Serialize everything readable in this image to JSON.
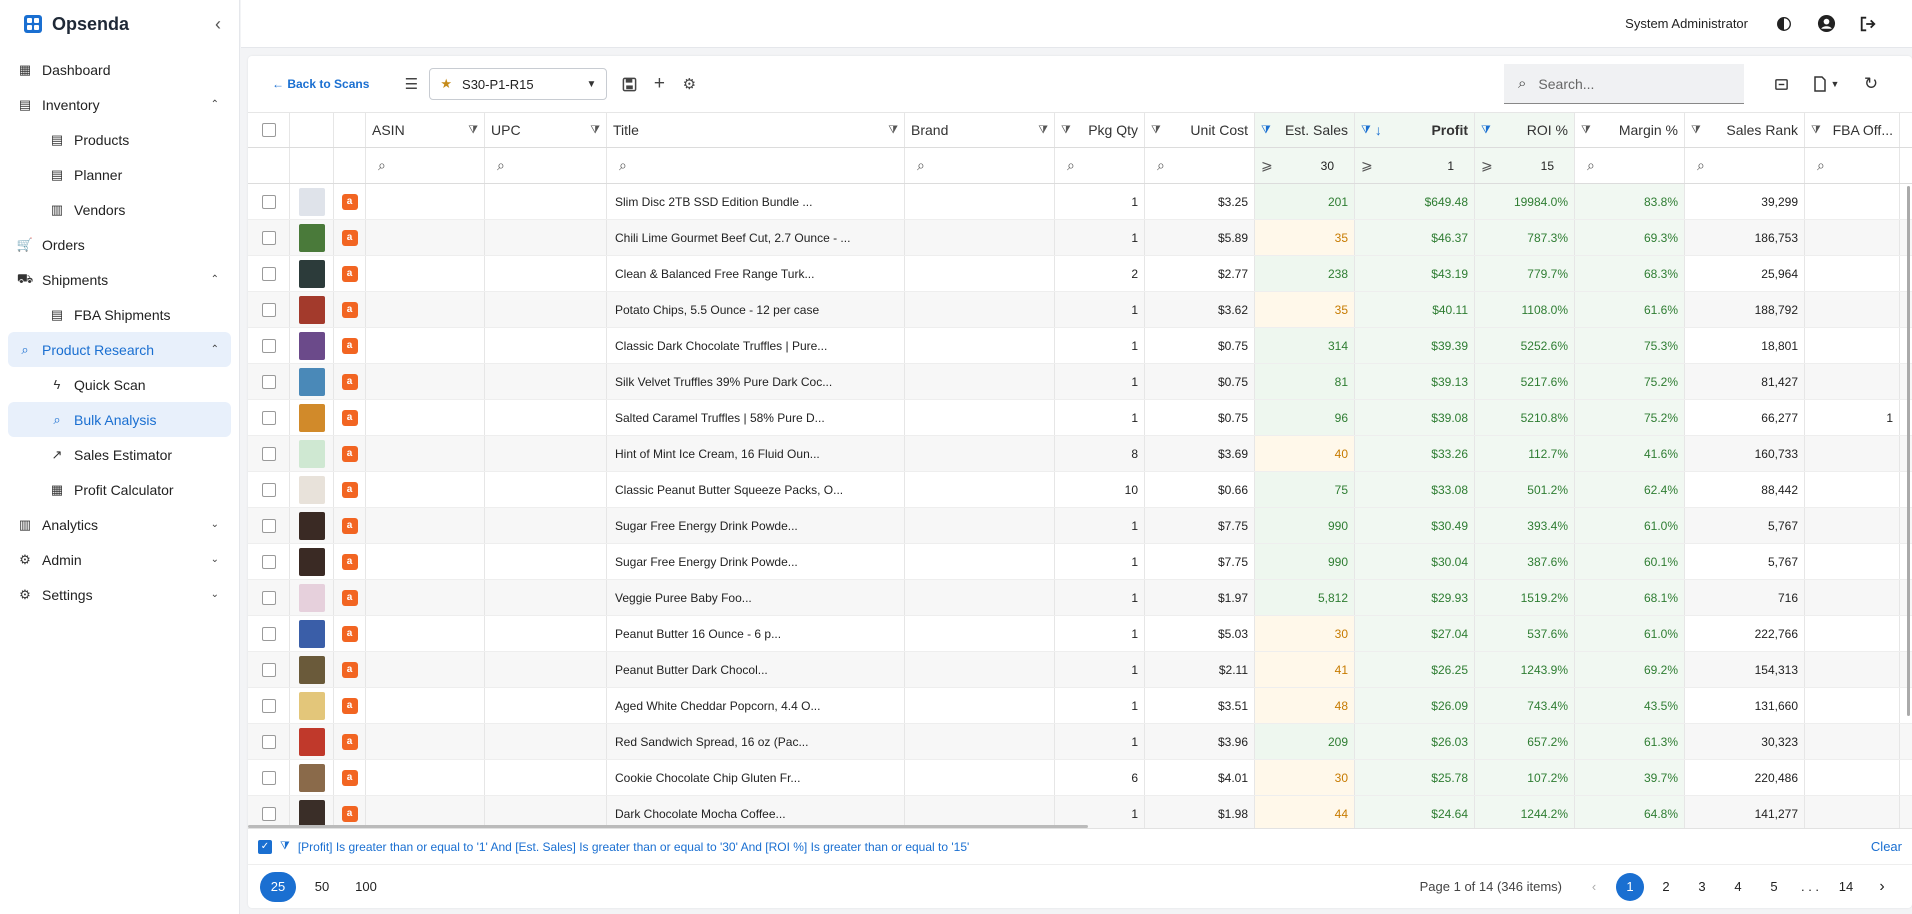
{
  "brand": {
    "name": "Opsenda"
  },
  "nav": [
    {
      "label": "Dashboard",
      "icon": "dashboard-icon",
      "glyph": "▦",
      "level": 0
    },
    {
      "label": "Inventory",
      "icon": "inventory-icon",
      "glyph": "▤",
      "level": 0,
      "chev": "⌃"
    },
    {
      "label": "Products",
      "icon": "products-icon",
      "glyph": "▤",
      "level": 1
    },
    {
      "label": "Planner",
      "icon": "planner-icon",
      "glyph": "▤",
      "level": 1
    },
    {
      "label": "Vendors",
      "icon": "vendors-icon",
      "glyph": "▥",
      "level": 1
    },
    {
      "label": "Orders",
      "icon": "cart-icon",
      "glyph": "🛒",
      "level": 0
    },
    {
      "label": "Shipments",
      "icon": "truck-icon",
      "glyph": "⛟",
      "level": 0,
      "chev": "⌃"
    },
    {
      "label": "FBA Shipments",
      "icon": "fba-shipments-icon",
      "glyph": "▤",
      "level": 1
    },
    {
      "label": "Product Research",
      "icon": "search-icon",
      "glyph": "⌕",
      "level": 0,
      "chev": "⌃",
      "state": "active-parent"
    },
    {
      "label": "Quick Scan",
      "icon": "bolt-icon",
      "glyph": "ϟ",
      "level": 1
    },
    {
      "label": "Bulk Analysis",
      "icon": "search-icon",
      "glyph": "⌕",
      "level": 1,
      "state": "active"
    },
    {
      "label": "Sales Estimator",
      "icon": "trend-icon",
      "glyph": "↗",
      "level": 1
    },
    {
      "label": "Profit Calculator",
      "icon": "calculator-icon",
      "glyph": "▦",
      "level": 1
    },
    {
      "label": "Analytics",
      "icon": "analytics-icon",
      "glyph": "▥",
      "level": 0,
      "chev": "⌄"
    },
    {
      "label": "Admin",
      "icon": "admin-icon",
      "glyph": "⚙",
      "level": 0,
      "chev": "⌄"
    },
    {
      "label": "Settings",
      "icon": "gear-icon",
      "glyph": "⚙",
      "level": 0,
      "chev": "⌄"
    }
  ],
  "topbar": {
    "user": "System Administrator"
  },
  "toolbar": {
    "back": "← Back to Scans",
    "scan_name": "S30-P1-R15",
    "search_placeholder": "Search..."
  },
  "columns": [
    {
      "key": "asin",
      "label": "ASIN",
      "filter": "text"
    },
    {
      "key": "upc",
      "label": "UPC",
      "filter": "text"
    },
    {
      "key": "title",
      "label": "Title",
      "filter": "text"
    },
    {
      "key": "brand",
      "label": "Brand",
      "filter": "text"
    },
    {
      "key": "pkg",
      "label": "Pkg Qty",
      "filter": "text"
    },
    {
      "key": "cost",
      "label": "Unit Cost",
      "filter": "text"
    },
    {
      "key": "sales",
      "label": "Est. Sales",
      "filter": "ge",
      "filter_value": "30"
    },
    {
      "key": "profit",
      "label": "Profit",
      "filter": "ge",
      "filter_value": "1",
      "sort": "↓"
    },
    {
      "key": "roi",
      "label": "ROI %",
      "filter": "ge",
      "filter_value": "15"
    },
    {
      "key": "margin",
      "label": "Margin %",
      "filter": "text"
    },
    {
      "key": "rank",
      "label": "Sales Rank",
      "filter": "text"
    },
    {
      "key": "fba",
      "label": "FBA Off...",
      "filter": "text"
    }
  ],
  "rows": [
    {
      "title": "Slim Disc 2TB SSD Edition Bundle ...",
      "pkg": "1",
      "cost": "$3.25",
      "sales": "201",
      "sales_level": "high",
      "profit": "$649.48",
      "roi": "19984.0%",
      "margin": "83.8%",
      "rank": "39,299",
      "fba": "",
      "thumb": "#dfe3ea"
    },
    {
      "title": "Chili Lime Gourmet Beef Cut, 2.7 Ounce - ...",
      "pkg": "1",
      "cost": "$5.89",
      "sales": "35",
      "sales_level": "low",
      "profit": "$46.37",
      "roi": "787.3%",
      "margin": "69.3%",
      "rank": "186,753",
      "fba": "",
      "thumb": "#4a7a3a"
    },
    {
      "title": "Clean & Balanced Free Range Turk...",
      "pkg": "2",
      "cost": "$2.77",
      "sales": "238",
      "sales_level": "high",
      "profit": "$43.19",
      "roi": "779.7%",
      "margin": "68.3%",
      "rank": "25,964",
      "fba": "",
      "thumb": "#2c3b3a"
    },
    {
      "title": "Potato Chips, 5.5 Ounce - 12 per case",
      "pkg": "1",
      "cost": "$3.62",
      "sales": "35",
      "sales_level": "low",
      "profit": "$40.11",
      "roi": "1108.0%",
      "margin": "61.6%",
      "rank": "188,792",
      "fba": "",
      "thumb": "#a33a2c"
    },
    {
      "title": "Classic Dark Chocolate Truffles | Pure...",
      "pkg": "1",
      "cost": "$0.75",
      "sales": "314",
      "sales_level": "high",
      "profit": "$39.39",
      "roi": "5252.6%",
      "margin": "75.3%",
      "rank": "18,801",
      "fba": "",
      "thumb": "#6b4a8a"
    },
    {
      "title": "Silk Velvet Truffles 39% Pure Dark Coc...",
      "pkg": "1",
      "cost": "$0.75",
      "sales": "81",
      "sales_level": "high",
      "profit": "$39.13",
      "roi": "5217.6%",
      "margin": "75.2%",
      "rank": "81,427",
      "fba": "",
      "thumb": "#4a89b8"
    },
    {
      "title": "Salted Caramel Truffles | 58% Pure D...",
      "pkg": "1",
      "cost": "$0.75",
      "sales": "96",
      "sales_level": "high",
      "profit": "$39.08",
      "roi": "5210.8%",
      "margin": "75.2%",
      "rank": "66,277",
      "fba": "1",
      "thumb": "#d18a2a"
    },
    {
      "title": "Hint of Mint Ice Cream, 16 Fluid Oun...",
      "pkg": "8",
      "cost": "$3.69",
      "sales": "40",
      "sales_level": "low",
      "profit": "$33.26",
      "roi": "112.7%",
      "margin": "41.6%",
      "rank": "160,733",
      "fba": "",
      "thumb": "#cfe8d2"
    },
    {
      "title": "Classic Peanut Butter Squeeze Packs, O...",
      "pkg": "10",
      "cost": "$0.66",
      "sales": "75",
      "sales_level": "high",
      "profit": "$33.08",
      "roi": "501.2%",
      "margin": "62.4%",
      "rank": "88,442",
      "fba": "",
      "thumb": "#e8e2da"
    },
    {
      "title": "Sugar Free Energy Drink Powde...",
      "pkg": "1",
      "cost": "$7.75",
      "sales": "990",
      "sales_level": "high",
      "profit": "$30.49",
      "roi": "393.4%",
      "margin": "61.0%",
      "rank": "5,767",
      "fba": "",
      "thumb": "#3a2a24"
    },
    {
      "title": "Sugar Free Energy Drink Powde...",
      "pkg": "1",
      "cost": "$7.75",
      "sales": "990",
      "sales_level": "high",
      "profit": "$30.04",
      "roi": "387.6%",
      "margin": "60.1%",
      "rank": "5,767",
      "fba": "",
      "thumb": "#3a2a24"
    },
    {
      "title": "Veggie Puree Baby Foo...",
      "pkg": "1",
      "cost": "$1.97",
      "sales": "5,812",
      "sales_level": "high",
      "profit": "$29.93",
      "roi": "1519.2%",
      "margin": "68.1%",
      "rank": "716",
      "fba": "",
      "thumb": "#e6d0dc"
    },
    {
      "title": "Peanut Butter 16 Ounce - 6 p...",
      "pkg": "1",
      "cost": "$5.03",
      "sales": "30",
      "sales_level": "low",
      "profit": "$27.04",
      "roi": "537.6%",
      "margin": "61.0%",
      "rank": "222,766",
      "fba": "",
      "thumb": "#3a5ea8"
    },
    {
      "title": "Peanut Butter Dark Chocol...",
      "pkg": "1",
      "cost": "$2.11",
      "sales": "41",
      "sales_level": "low",
      "profit": "$26.25",
      "roi": "1243.9%",
      "margin": "69.2%",
      "rank": "154,313",
      "fba": "",
      "thumb": "#6a5a3a"
    },
    {
      "title": "Aged White Cheddar Popcorn, 4.4 O...",
      "pkg": "1",
      "cost": "$3.51",
      "sales": "48",
      "sales_level": "low",
      "profit": "$26.09",
      "roi": "743.4%",
      "margin": "43.5%",
      "rank": "131,660",
      "fba": "",
      "thumb": "#e3c67a"
    },
    {
      "title": "Red Sandwich Spread, 16 oz (Pac...",
      "pkg": "1",
      "cost": "$3.96",
      "sales": "209",
      "sales_level": "high",
      "profit": "$26.03",
      "roi": "657.2%",
      "margin": "61.3%",
      "rank": "30,323",
      "fba": "",
      "thumb": "#c0392b"
    },
    {
      "title": "Cookie Chocolate Chip Gluten Fr...",
      "pkg": "6",
      "cost": "$4.01",
      "sales": "30",
      "sales_level": "low",
      "profit": "$25.78",
      "roi": "107.2%",
      "margin": "39.7%",
      "rank": "220,486",
      "fba": "",
      "thumb": "#8a6a4a"
    },
    {
      "title": "Dark Chocolate Mocha Coffee...",
      "pkg": "1",
      "cost": "$1.98",
      "sales": "44",
      "sales_level": "low",
      "profit": "$24.64",
      "roi": "1244.2%",
      "margin": "64.8%",
      "rank": "141,277",
      "fba": "",
      "thumb": "#3a2e28"
    }
  ],
  "filter_expression": "[Profit] Is greater than or equal to '1' And [Est. Sales] Is greater than or equal to '30' And [ROI %] Is greater than or equal to '15'",
  "clear_label": "Clear",
  "page_sizes": [
    "25",
    "50",
    "100"
  ],
  "selected_page_size": "25",
  "page_info": "Page 1 of 14 (346 items)",
  "pages": [
    "1",
    "2",
    "3",
    "4",
    "5",
    ". . .",
    "14"
  ],
  "current_page": "1"
}
